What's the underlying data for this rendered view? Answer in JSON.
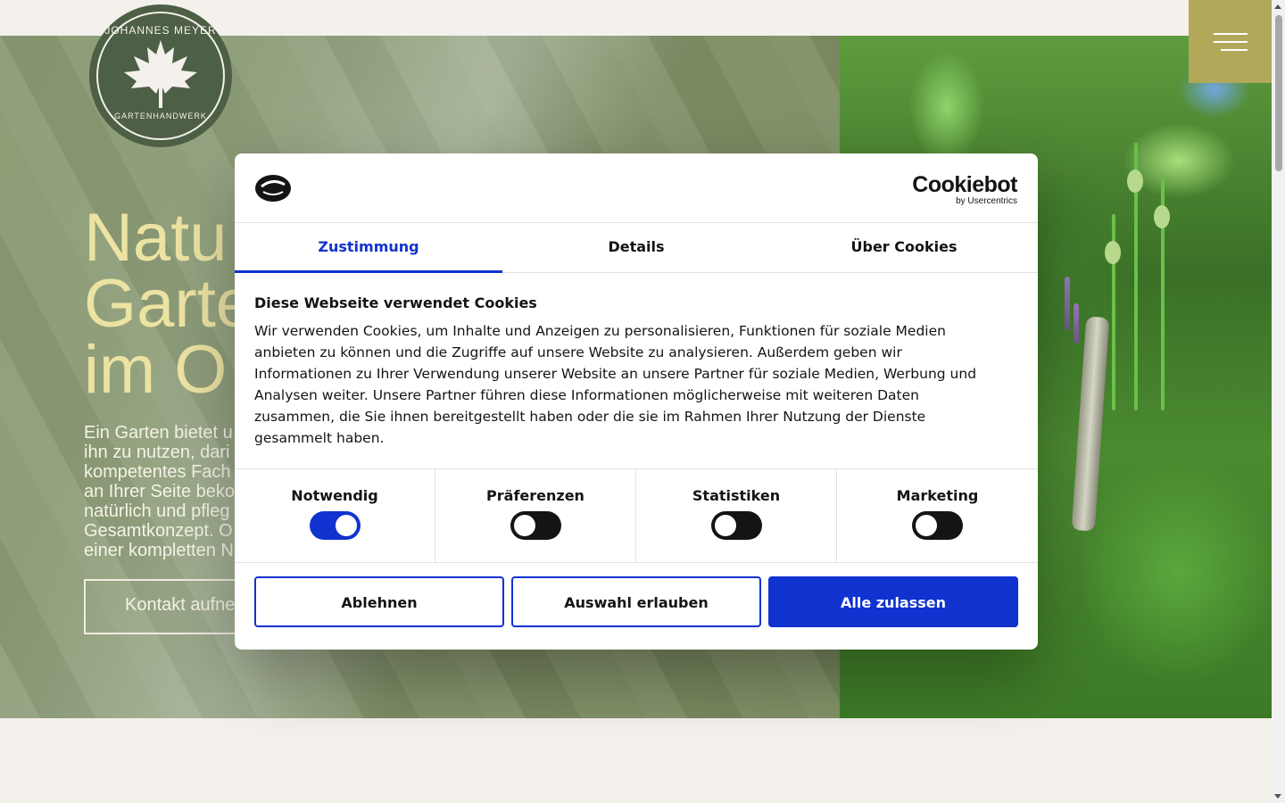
{
  "hero": {
    "title_lines": [
      "Natu",
      "Garte",
      "im O"
    ],
    "text_lines": [
      "Ein Garten bietet u",
      "ihn zu nutzen, dari",
      "kompetentes Fach",
      "an Ihrer Seite beko",
      "natürlich und pfleg",
      "Gesamtkonzept. O",
      "einer kompletten N"
    ],
    "button_label": "Kontakt aufne"
  },
  "logo": {
    "top_text": "JOHANNES MEYER",
    "bottom_text": "GARTENHANDWERK"
  },
  "menu": {
    "icon": "hamburger-menu-icon",
    "color": "#b2a85a"
  },
  "cookie_dialog": {
    "brand": "Cookiebot",
    "brand_sub": "by Usercentrics",
    "tabs": [
      "Zustimmung",
      "Details",
      "Über Cookies"
    ],
    "active_tab": "Zustimmung",
    "heading": "Diese Webseite verwendet Cookies",
    "body_lines": [
      "Wir verwenden Cookies, um Inhalte und Anzeigen zu personalisieren, Funktionen für soziale Medien",
      "anbieten zu können und die Zugriffe auf unsere Website zu analysieren. Außerdem geben wir",
      "Informationen zu Ihrer Verwendung unserer Website an unsere Partner für soziale Medien, Werbung und",
      "Analysen weiter. Unsere Partner führen diese Informationen möglicherweise mit weiteren Daten",
      "zusammen, die Sie ihnen bereitgestellt haben oder die sie im Rahmen Ihrer Nutzung der Dienste",
      "gesammelt haben."
    ],
    "toggles": [
      {
        "label": "Notwendig",
        "on": true
      },
      {
        "label": "Präferenzen",
        "on": false
      },
      {
        "label": "Statistiken",
        "on": false
      },
      {
        "label": "Marketing",
        "on": false
      }
    ],
    "buttons": {
      "decline": "Ablehnen",
      "allow_selection": "Auswahl erlauben",
      "allow_all": "Alle zulassen"
    },
    "accent_color": "#1032cf"
  }
}
